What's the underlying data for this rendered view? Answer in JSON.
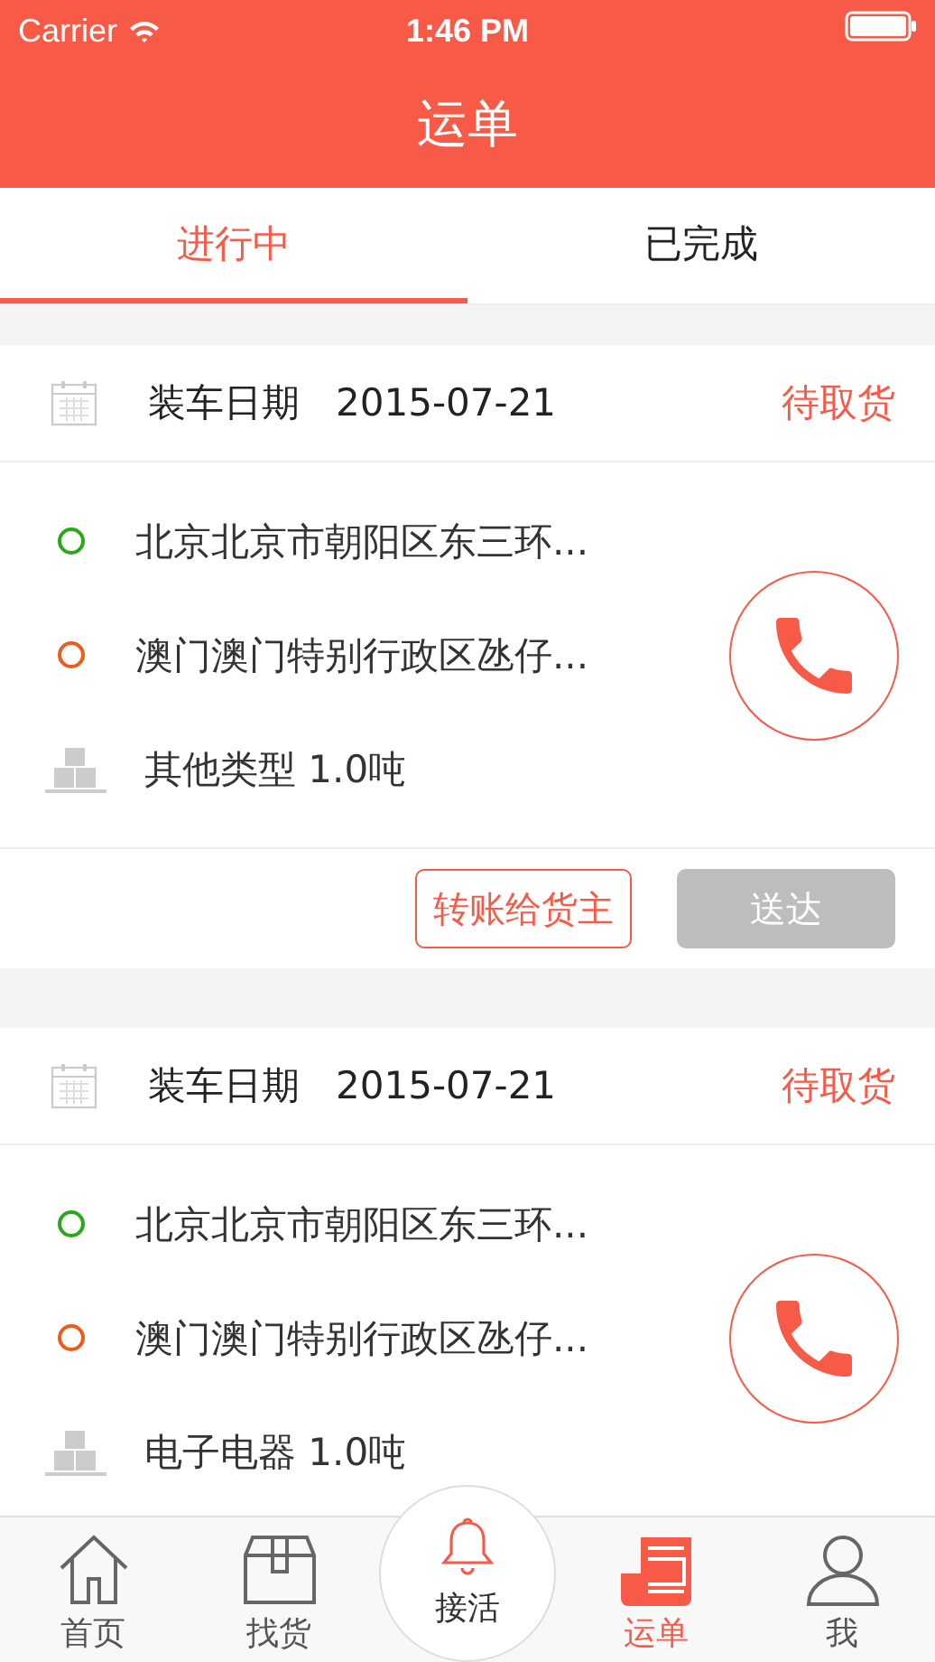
{
  "status_bar": {
    "carrier": "Carrier",
    "time": "1:46 PM"
  },
  "nav": {
    "title": "运单"
  },
  "tabs": [
    {
      "label": "进行中",
      "selected": true
    },
    {
      "label": "已完成",
      "selected": false
    }
  ],
  "orders": [
    {
      "date_label": "装车日期",
      "date": "2015-07-21",
      "status": "待取货",
      "origin": "北京北京市朝阳区东三环...",
      "destination": "澳门澳门特别行政区氹仔...",
      "cargo": "其他类型 1.0吨",
      "actions": [
        {
          "label": "转账给货主",
          "kind": "outline"
        },
        {
          "label": "送达",
          "kind": "disabled"
        }
      ]
    },
    {
      "date_label": "装车日期",
      "date": "2015-07-21",
      "status": "待取货",
      "origin": "北京北京市朝阳区东三环...",
      "destination": "澳门澳门特别行政区氹仔...",
      "cargo": "电子电器 1.0吨"
    }
  ],
  "tab_bar": [
    {
      "label": "首页",
      "kind": "home",
      "selected": false
    },
    {
      "label": "找货",
      "kind": "box",
      "selected": false
    },
    {
      "label": "接活",
      "kind": "bell",
      "selected": false
    },
    {
      "label": "运单",
      "kind": "doc",
      "selected": true
    },
    {
      "label": "我",
      "kind": "person",
      "selected": false
    }
  ]
}
